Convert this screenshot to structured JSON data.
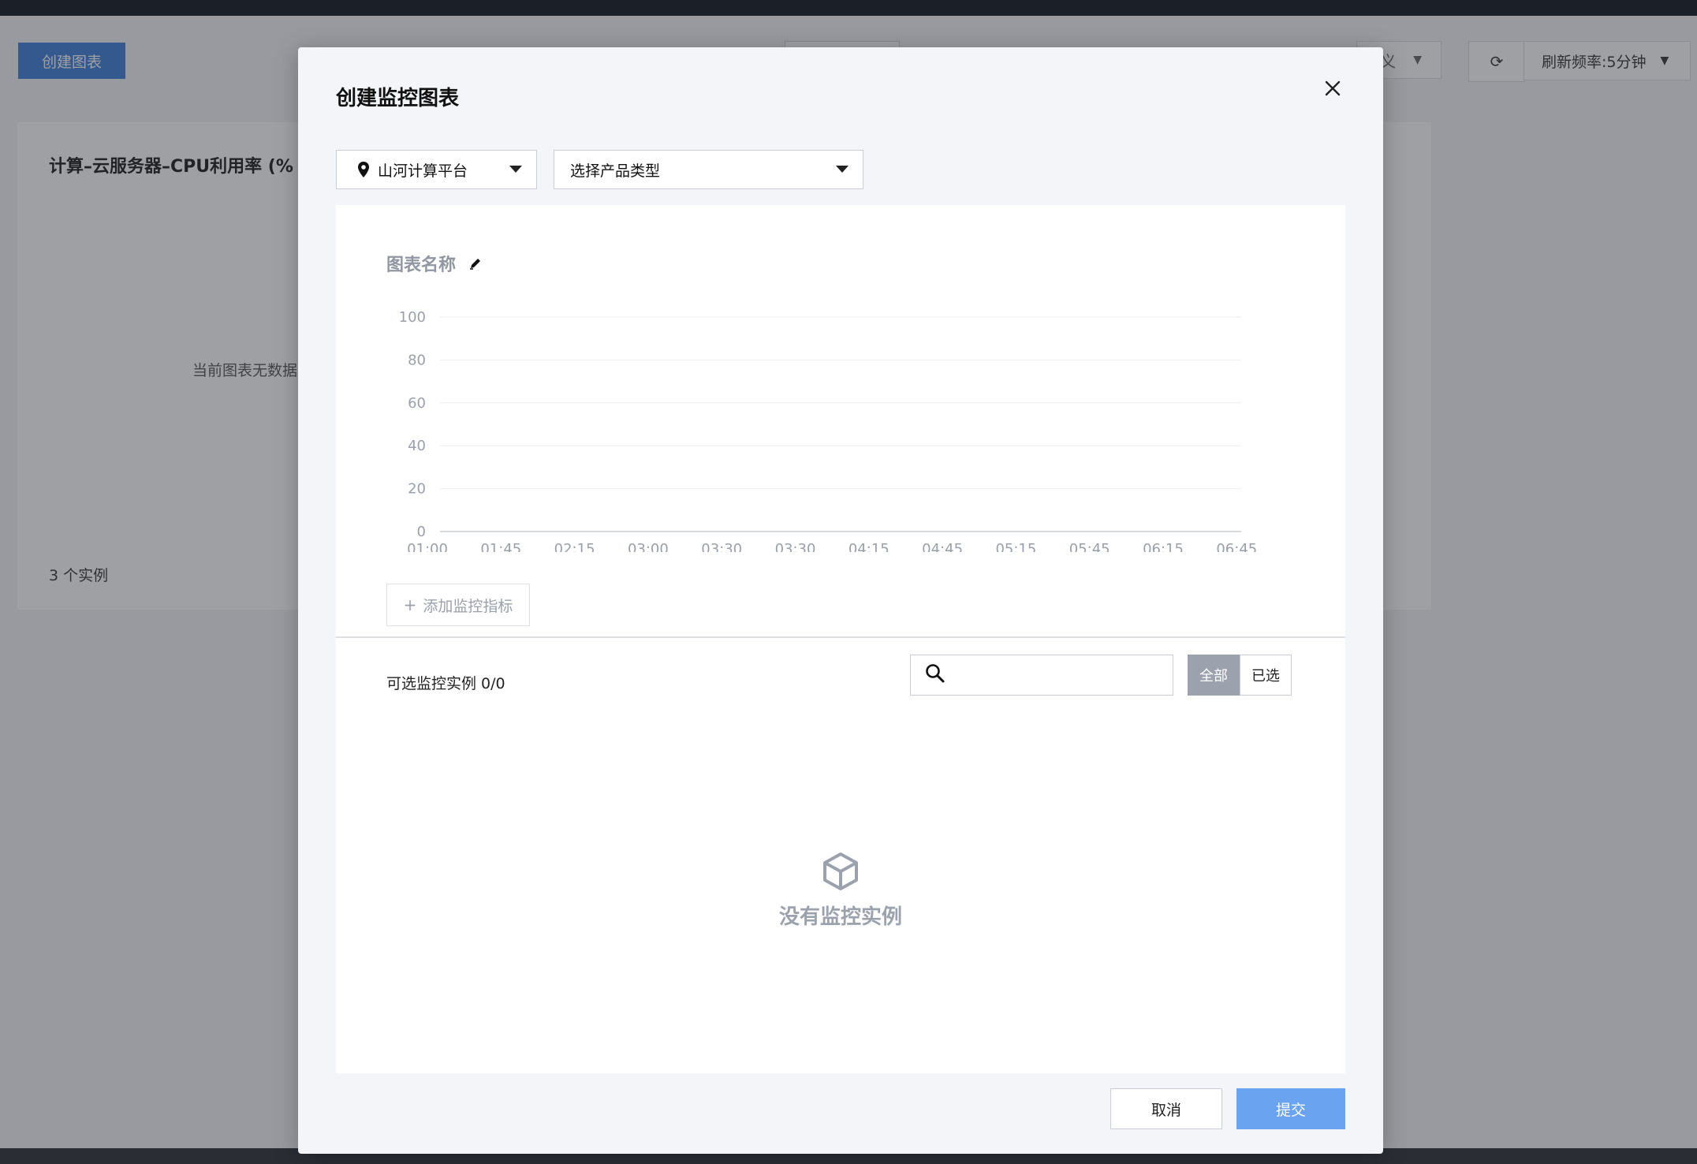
{
  "background": {
    "create_chart_button": "创建图表",
    "view_select_text": "义",
    "refresh_rate": "刷新频率:5分钟",
    "card": {
      "title": "计算–云服务器–CPU利用率 (%",
      "empty_text": "当前图表无数据",
      "instance_count": "3 个实例"
    }
  },
  "modal": {
    "title": "创建监控图表",
    "platform_select": "山河计算平台",
    "product_select": "选择产品类型",
    "chart_name": "图表名称",
    "add_metric": "添加监控指标",
    "instances_label": "可选监控实例 0/0",
    "search_placeholder": "",
    "filter_all": "全部",
    "filter_selected": "已选",
    "empty_text": "没有监控实例",
    "cancel": "取消",
    "submit": "提交"
  },
  "icons": [
    "location-pin-icon",
    "chevron-down-icon",
    "close-icon",
    "pencil-icon",
    "search-icon",
    "box-icon",
    "refresh-icon"
  ],
  "colors": {
    "primary": "#6aa4f0",
    "muted": "#9ba2ae"
  },
  "chart_data": {
    "type": "line",
    "title": "图表名称",
    "x": [
      "01:00",
      "01:45",
      "02:15",
      "03:00",
      "03:30",
      "03:30",
      "04:15",
      "04:45",
      "05:15",
      "05:45",
      "06:15",
      "06:45"
    ],
    "series": [],
    "y_ticks": [
      0,
      20,
      40,
      60,
      80,
      100
    ],
    "ylim": [
      0,
      100
    ],
    "grid": true
  }
}
